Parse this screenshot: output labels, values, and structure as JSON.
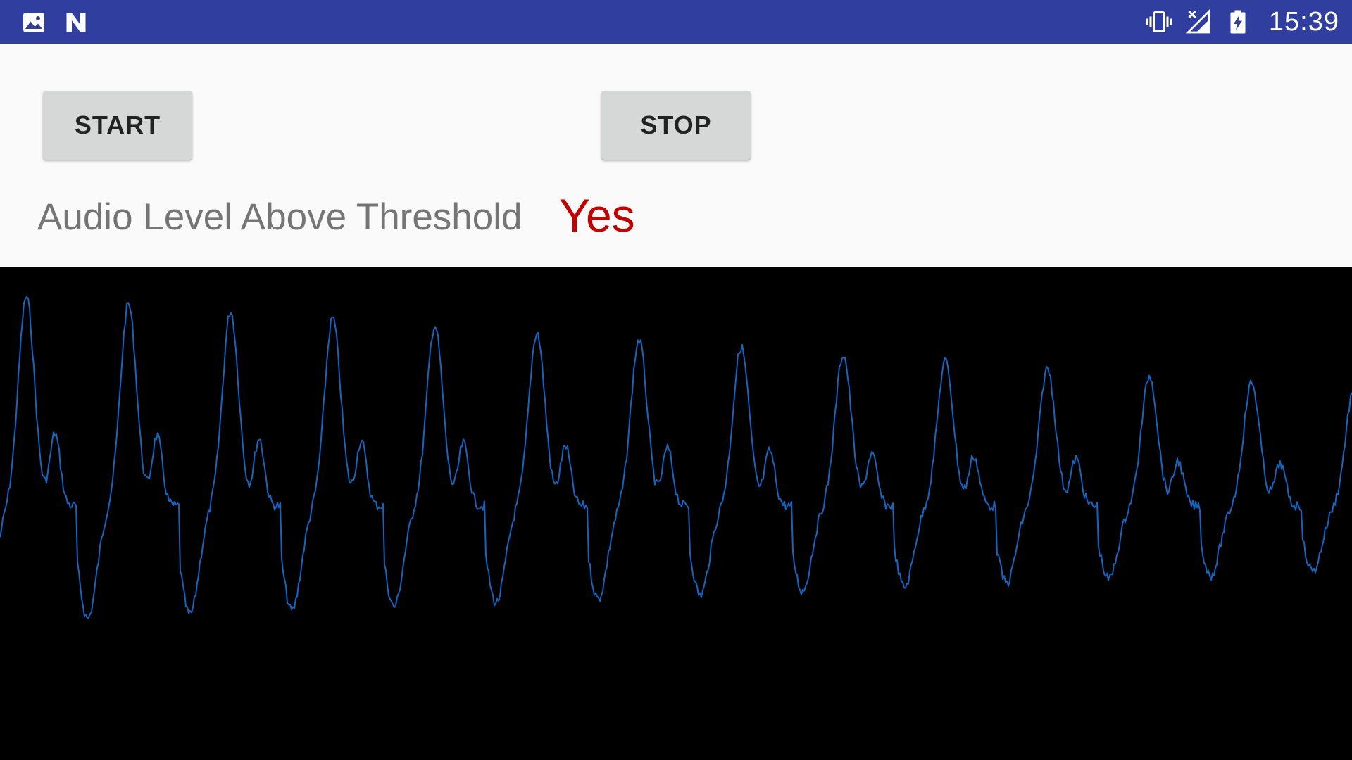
{
  "status_bar": {
    "background": "#303f9f",
    "left_icons": [
      "image-icon",
      "n-logo-icon"
    ],
    "right_icons": [
      "vibrate-icon",
      "signal-off-icon",
      "battery-charging-icon"
    ],
    "time": "15:39"
  },
  "controls": {
    "start_label": "START",
    "stop_label": "STOP",
    "button_color": "#d6d7d7"
  },
  "threshold": {
    "label": "Audio Level Above Threshold",
    "value": "Yes",
    "value_color": "#c40000"
  },
  "waveform": {
    "background": "#000000",
    "line_color": "#1565c0"
  }
}
